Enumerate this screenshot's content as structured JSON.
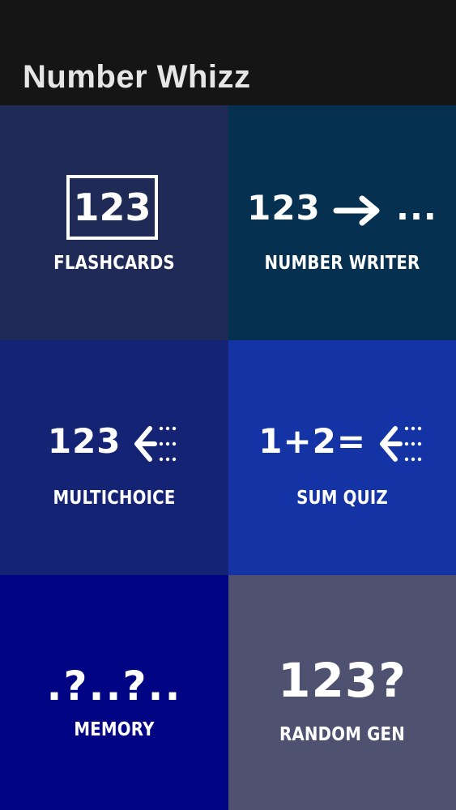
{
  "header": {
    "title": "Number Whizz"
  },
  "tiles": [
    {
      "label": "FLASHCARDS",
      "glyph": "123",
      "bg": "#1f2a57"
    },
    {
      "label": "NUMBER WRITER",
      "glyph": "123",
      "trail": "...",
      "bg": "#05304f"
    },
    {
      "label": "MULTICHOICE",
      "glyph": "123",
      "bg": "#152374"
    },
    {
      "label": "SUM QUIZ",
      "glyph": "1+2=",
      "bg": "#1434a6"
    },
    {
      "label": "MEMORY",
      "glyph": ".?..?..",
      "bg": "#010483"
    },
    {
      "label": "RANDOM GEN",
      "glyph": "123?",
      "bg": "#4e516f"
    }
  ]
}
